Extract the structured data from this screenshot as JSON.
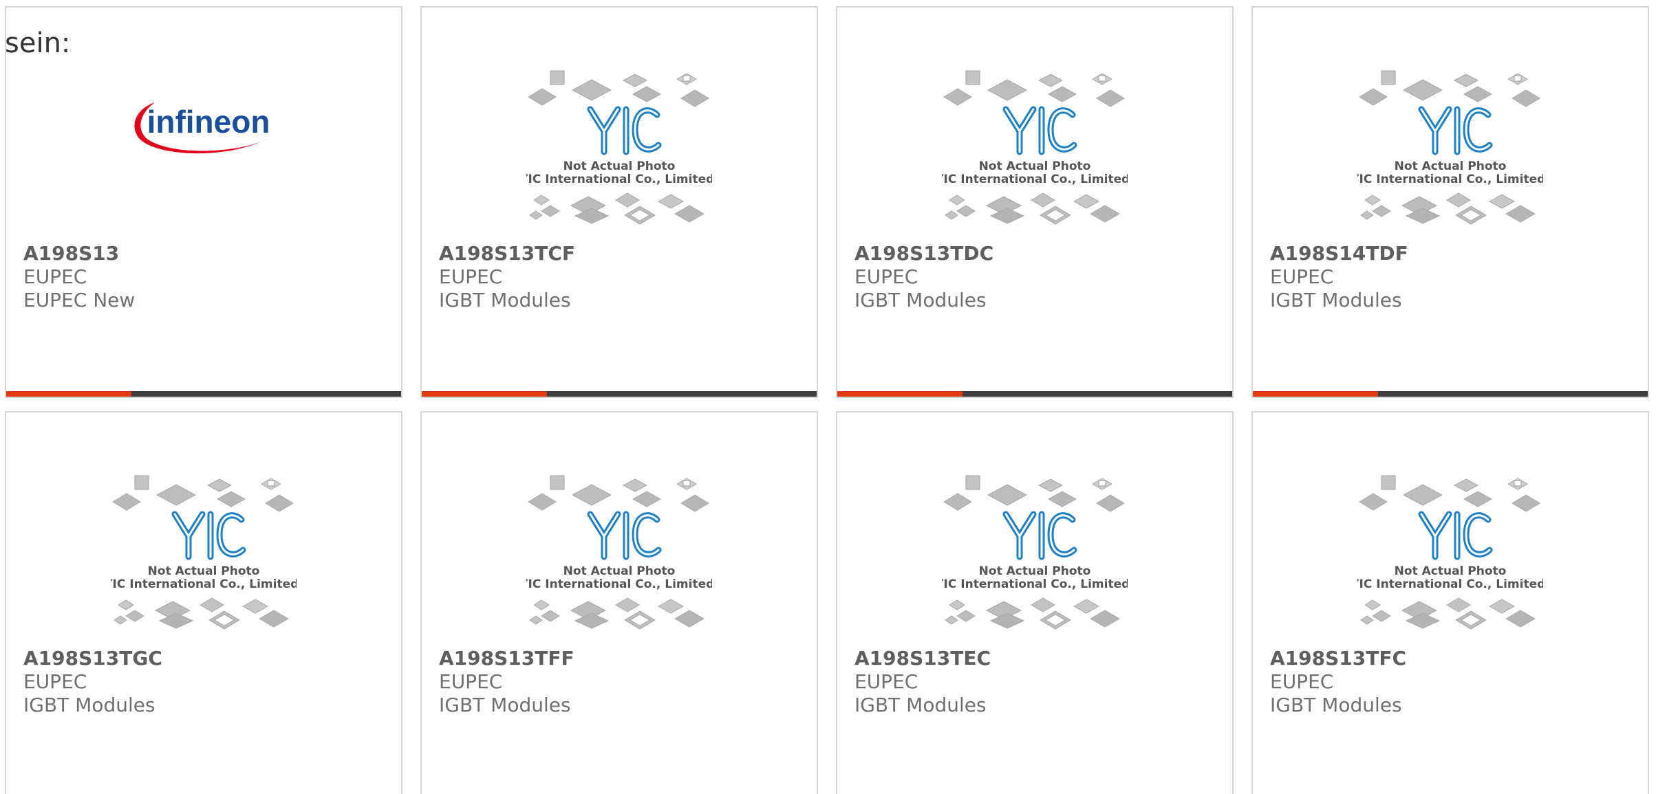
{
  "intro_text": "sein:",
  "colors": {
    "accent_bar": "#e03c14",
    "bar_dark": "#3d3d3d",
    "infineon_text": "#1a4f9c",
    "infineon_swoosh": "#e2001a",
    "yic_blue": "#1d7fc4"
  },
  "placeholder": {
    "line1": "Not Actual Photo",
    "line2": "YIC International Co., Limited."
  },
  "products": [
    {
      "part": "A198S13",
      "brand": "EUPEC",
      "category": "EUPEC New",
      "image": "infineon-logo",
      "logo_text": "infineon"
    },
    {
      "part": "A198S13TCF",
      "brand": "EUPEC",
      "category": "IGBT Modules",
      "image": "yic-placeholder"
    },
    {
      "part": "A198S13TDC",
      "brand": "EUPEC",
      "category": "IGBT Modules",
      "image": "yic-placeholder"
    },
    {
      "part": "A198S14TDF",
      "brand": "EUPEC",
      "category": "IGBT Modules",
      "image": "yic-placeholder"
    },
    {
      "part": "A198S13TGC",
      "brand": "EUPEC",
      "category": "IGBT Modules",
      "image": "yic-placeholder"
    },
    {
      "part": "A198S13TFF",
      "brand": "EUPEC",
      "category": "IGBT Modules",
      "image": "yic-placeholder"
    },
    {
      "part": "A198S13TEC",
      "brand": "EUPEC",
      "category": "IGBT Modules",
      "image": "yic-placeholder"
    },
    {
      "part": "A198S13TFC",
      "brand": "EUPEC",
      "category": "IGBT Modules",
      "image": "yic-placeholder"
    }
  ]
}
